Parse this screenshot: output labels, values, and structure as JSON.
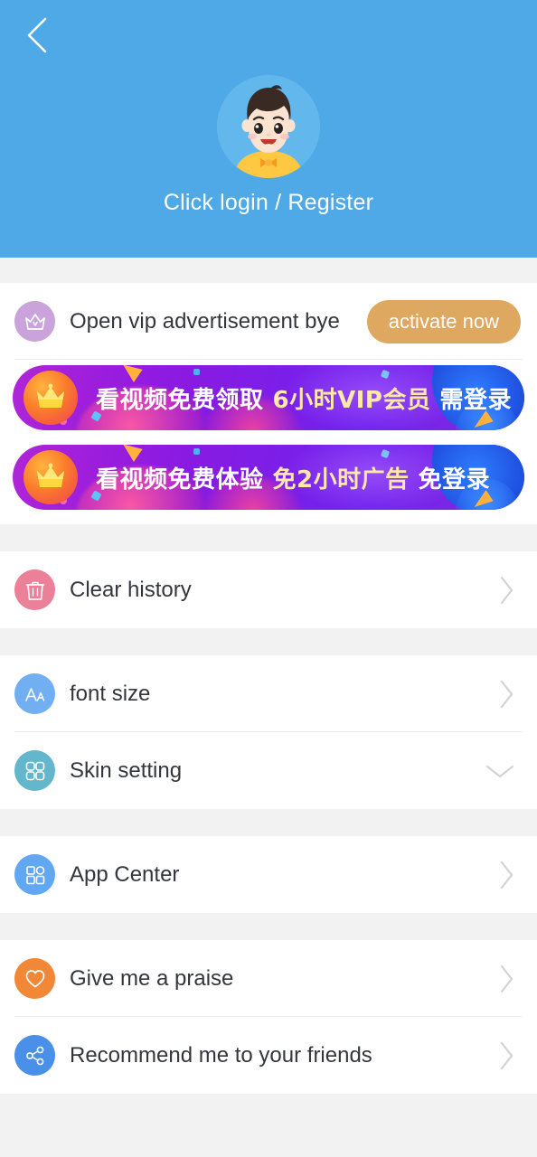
{
  "theme": {
    "header_bg": "#4fa9e6",
    "page_bg": "#f2f2f2",
    "card_bg": "#ffffff",
    "text_primary": "#33373d",
    "accent_gold": "#dfa860",
    "banner_accent_text": "#ffe9a8"
  },
  "header": {
    "back_icon": "chevron-left-icon",
    "avatar_icon": "user-avatar-boy",
    "login_text": "Click login / Register"
  },
  "vip_row": {
    "icon": "crown-icon",
    "icon_bg": "#c9a3d9",
    "label": "Open vip advertisement bye",
    "button_label": "activate now"
  },
  "banners": [
    {
      "icon": "crown-badge-icon",
      "segments": [
        {
          "text": "看视频免费领取",
          "accent": false
        },
        {
          "text": "6小时VIP会员",
          "accent": true
        },
        {
          "text": "需登录",
          "accent": false
        }
      ],
      "full_text": "看视频免费领取 6小时VIP会员 需登录"
    },
    {
      "icon": "crown-badge-icon",
      "segments": [
        {
          "text": "看视频免费体验",
          "accent": false
        },
        {
          "text": "免2小时广告",
          "accent": true
        },
        {
          "text": "免登录",
          "accent": false
        }
      ],
      "full_text": "看视频免费体验 免2小时广告 免登录"
    }
  ],
  "sections": [
    {
      "name": "history",
      "rows": [
        {
          "id": "clear-history",
          "label": "Clear history",
          "icon": "trash-icon",
          "icon_bg": "#eb8098",
          "chevron": "chevron-right-icon"
        }
      ]
    },
    {
      "name": "appearance",
      "rows": [
        {
          "id": "font-size",
          "label": "font size",
          "icon": "font-size-icon",
          "icon_bg": "#72aff2",
          "chevron": "chevron-right-icon"
        },
        {
          "id": "skin-setting",
          "label": "Skin setting",
          "icon": "skin-grid-icon",
          "icon_bg": "#63b6cc",
          "chevron": "chevron-down-icon"
        }
      ]
    },
    {
      "name": "apps",
      "rows": [
        {
          "id": "app-center",
          "label": "App Center",
          "icon": "app-grid-icon",
          "icon_bg": "#62a7f2",
          "chevron": "chevron-right-icon"
        }
      ]
    },
    {
      "name": "social",
      "rows": [
        {
          "id": "give-praise",
          "label": "Give me a praise",
          "icon": "heart-icon",
          "icon_bg": "#f08837",
          "chevron": "chevron-right-icon"
        },
        {
          "id": "recommend-friends",
          "label": "Recommend me to your friends",
          "icon": "share-icon",
          "icon_bg": "#4a90e8",
          "chevron": "chevron-right-icon"
        }
      ]
    }
  ]
}
